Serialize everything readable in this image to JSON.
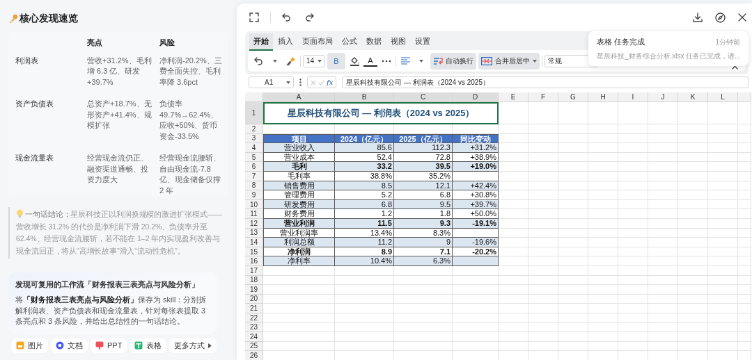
{
  "findings": {
    "title": "核心发现速览",
    "columns": [
      "亮点",
      "风险"
    ],
    "rows": [
      {
        "label": "利润表",
        "highlights": "营收+31.2%、毛利增 6.3 亿、研发+39.7%",
        "risks": "净利润-20.2%、三费全面失控、毛利率降 3.6pct"
      },
      {
        "label": "资产负债表",
        "highlights": "总资产+18.7%、无形资产+41.4%、规模扩张",
        "risks": "负债率 49.7%→62.4%、应收+50%、货币资金-33.5%"
      },
      {
        "label": "现金流量表",
        "highlights": "经营现金流仍正、融资渠道通畅、投资力度大",
        "risks": "经营现金流腰斩、自由现金流-7.8 亿、现金储备仅撑 2 年"
      }
    ],
    "conclusion": "**一句话结论：**星辰科技正以利润换规模的激进扩张模式——营收增长 31.2% 的代价是净利润下滑 20.2%、负债率升至 62.4%、经营现金流腰斩，若不能在 1–2 年内实现盈利改善与现金流回正，将从“高增长故事”滑入“流动性危机”。",
    "workflow": {
      "title": "发现可复用的工作流「财务报表三表亮点与风险分析」",
      "text": "将**「财务报表三表亮点与风险分析」**保存为 skill：分别拆解利润表、资产负债表和现金流量表，针对每张表提取 3 条亮点和 3 条风险，并给出总结性的一句话结论。"
    },
    "actions": [
      {
        "kind": "image",
        "label": "图片"
      },
      {
        "kind": "doc",
        "label": "文档"
      },
      {
        "kind": "ppt",
        "label": "PPT"
      },
      {
        "kind": "sheet",
        "label": "表格"
      },
      {
        "kind": "more",
        "label": "更多方式"
      }
    ]
  },
  "spreadsheet": {
    "tabs": [
      {
        "label": "开始",
        "selected": true
      },
      {
        "label": "插入",
        "selected": false
      },
      {
        "label": "页面布局",
        "selected": false
      },
      {
        "label": "公式",
        "selected": false
      },
      {
        "label": "数据",
        "selected": false
      },
      {
        "label": "视图",
        "selected": false
      },
      {
        "label": "设置",
        "selected": false
      }
    ],
    "toolbar": {
      "font_size": "14",
      "bold": {
        "label": "B",
        "on": true
      },
      "font_color": {
        "label": "A"
      },
      "wrap_text": {
        "label": "自动换行",
        "on": true
      },
      "merge": {
        "label": "合并后居中",
        "on": true
      },
      "number_format": "常规"
    },
    "notification": {
      "title": "表格 任务完成",
      "time": "1分钟前",
      "message": "星辰科技_财务综合分析.xlsx 任务已完成，请..."
    },
    "formula_bar": {
      "cell": "A1",
      "function_label": "fx",
      "formula": "星辰科技有限公司 — 利润表（2024 vs 2025）"
    },
    "columns": [
      {
        "label": "A",
        "selected": true
      },
      {
        "label": "B",
        "selected": true
      },
      {
        "label": "C",
        "selected": true
      },
      {
        "label": "D",
        "selected": true
      },
      {
        "label": "E",
        "selected": false
      },
      {
        "label": "F",
        "selected": false
      },
      {
        "label": "G",
        "selected": false
      },
      {
        "label": "H",
        "selected": false
      },
      {
        "label": "I",
        "selected": false
      },
      {
        "label": "J",
        "selected": false
      },
      {
        "label": "K",
        "selected": false
      },
      {
        "label": "L",
        "selected": false
      }
    ],
    "row_numbers": [
      {
        "label": "1",
        "selected": true
      },
      {
        "label": "2",
        "selected": false
      },
      {
        "label": "3",
        "selected": false
      },
      {
        "label": "4",
        "selected": false
      },
      {
        "label": "5",
        "selected": false
      },
      {
        "label": "6",
        "selected": false
      },
      {
        "label": "7",
        "selected": false
      },
      {
        "label": "8",
        "selected": false
      },
      {
        "label": "9",
        "selected": false
      },
      {
        "label": "10",
        "selected": false
      },
      {
        "label": "11",
        "selected": false
      },
      {
        "label": "12",
        "selected": false
      },
      {
        "label": "13",
        "selected": false
      },
      {
        "label": "14",
        "selected": false
      },
      {
        "label": "15",
        "selected": false
      },
      {
        "label": "16",
        "selected": false
      },
      {
        "label": "17",
        "selected": false
      },
      {
        "label": "18",
        "selected": false
      },
      {
        "label": "19",
        "selected": false
      },
      {
        "label": "20",
        "selected": false
      },
      {
        "label": "21",
        "selected": false
      },
      {
        "label": "22",
        "selected": false
      },
      {
        "label": "23",
        "selected": false
      },
      {
        "label": "24",
        "selected": false
      },
      {
        "label": "25",
        "selected": false
      },
      {
        "label": "26",
        "selected": false
      }
    ],
    "title": {
      "text": "星辰科技有限公司 — 利润表（2024 vs 2025）",
      "selected": true
    },
    "header": [
      "项目",
      "2024（亿元）",
      "2025（亿元）",
      "同比变动"
    ],
    "rows": [
      {
        "cells": [
          "营业收入",
          "85.6",
          "112.3",
          "+31.2%"
        ],
        "bold": false,
        "shaded": true
      },
      {
        "cells": [
          "营业成本",
          "52.4",
          "72.8",
          "+38.9%"
        ],
        "bold": false,
        "shaded": false
      },
      {
        "cells": [
          "毛利",
          "33.2",
          "39.5",
          "+19.0%"
        ],
        "bold": true,
        "shaded": true
      },
      {
        "cells": [
          "毛利率",
          "38.8%",
          "35.2%"
        ],
        "bold": false,
        "shaded": false
      },
      {
        "cells": [
          "销售费用",
          "8.5",
          "12.1",
          "+42.4%"
        ],
        "bold": false,
        "shaded": true
      },
      {
        "cells": [
          "管理费用",
          "5.2",
          "6.8",
          "+30.8%"
        ],
        "bold": false,
        "shaded": false
      },
      {
        "cells": [
          "研发费用",
          "6.8",
          "9.5",
          "+39.7%"
        ],
        "bold": false,
        "shaded": true
      },
      {
        "cells": [
          "财务费用",
          "1.2",
          "1.8",
          "+50.0%"
        ],
        "bold": false,
        "shaded": false
      },
      {
        "cells": [
          "营业利润",
          "11.5",
          "9.3",
          "-19.1%"
        ],
        "bold": true,
        "shaded": true
      },
      {
        "cells": [
          "营业利润率",
          "13.4%",
          "8.3%"
        ],
        "bold": false,
        "shaded": false
      },
      {
        "cells": [
          "利润总额",
          "11.2",
          "9",
          "-19.6%"
        ],
        "bold": false,
        "shaded": true
      },
      {
        "cells": [
          "净利润",
          "8.9",
          "7.1",
          "-20.2%"
        ],
        "bold": true,
        "shaded": false
      },
      {
        "cells": [
          "净利率",
          "10.4%",
          "6.3%"
        ],
        "bold": false,
        "shaded": true
      }
    ]
  }
}
